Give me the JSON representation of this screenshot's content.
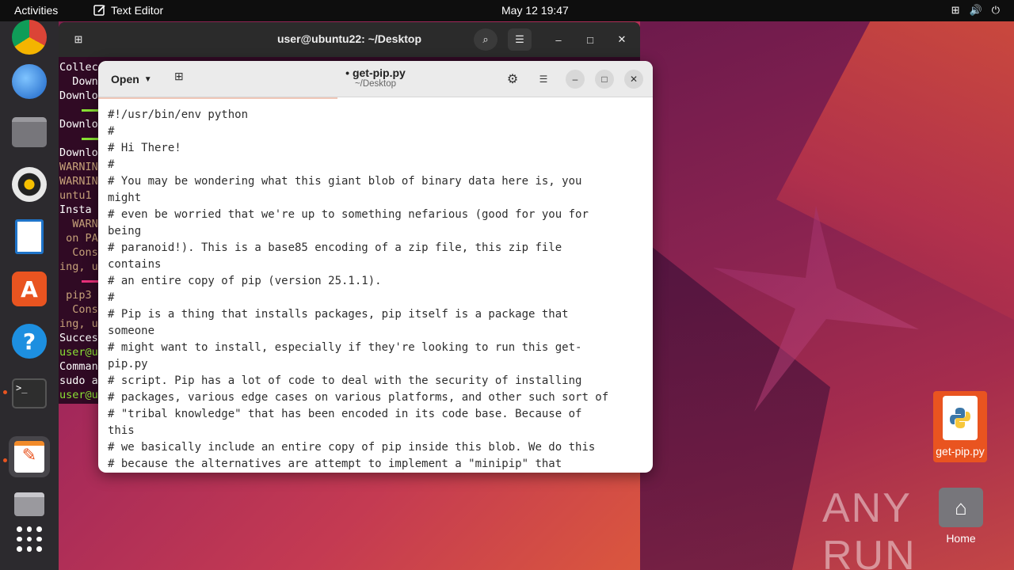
{
  "topbar": {
    "activities": "Activities",
    "app_name": "Text Editor",
    "clock": "May 12  19:47"
  },
  "terminal": {
    "title": "user@ubuntu22: ~/Desktop",
    "lines": [
      "Collec",
      "  Down",
      "Downlo",
      "",
      "Downlo",
      "",
      "Downlo",
      "WARNIN",
      "WARNIN",
      "untu1",
      "Insta",
      "  WARN",
      " on PA",
      "  Cons",
      "ing, u",
      "",
      " pip3",
      "  Cons",
      "ing, u",
      "Succes",
      "user@u",
      "Comman",
      "sudo a",
      "user@u"
    ]
  },
  "editor": {
    "open_label": "Open",
    "title": "• get-pip.py",
    "subtitle": "~/Desktop",
    "code": "#!/usr/bin/env python\n#\n# Hi There!\n#\n# You may be wondering what this giant blob of binary data here is, you\nmight\n# even be worried that we're up to something nefarious (good for you for\nbeing\n# paranoid!). This is a base85 encoding of a zip file, this zip file\ncontains\n# an entire copy of pip (version 25.1.1).\n#\n# Pip is a thing that installs packages, pip itself is a package that\nsomeone\n# might want to install, especially if they're looking to run this get-\npip.py\n# script. Pip has a lot of code to deal with the security of installing\n# packages, various edge cases on various platforms, and other such sort of\n# \"tribal knowledge\" that has been encoded in its code base. Because of\nthis\n# we basically include an entire copy of pip inside this blob. We do this\n# because the alternatives are attempt to implement a \"minipip\" that"
  },
  "desktop": {
    "file_label": "get-pip.py",
    "home_label": "Home"
  },
  "watermark": "ANY RUN",
  "colors": {
    "accent": "#e95420",
    "terminal_bg": "#300a24",
    "dock_bg": "#2c2a2e"
  }
}
